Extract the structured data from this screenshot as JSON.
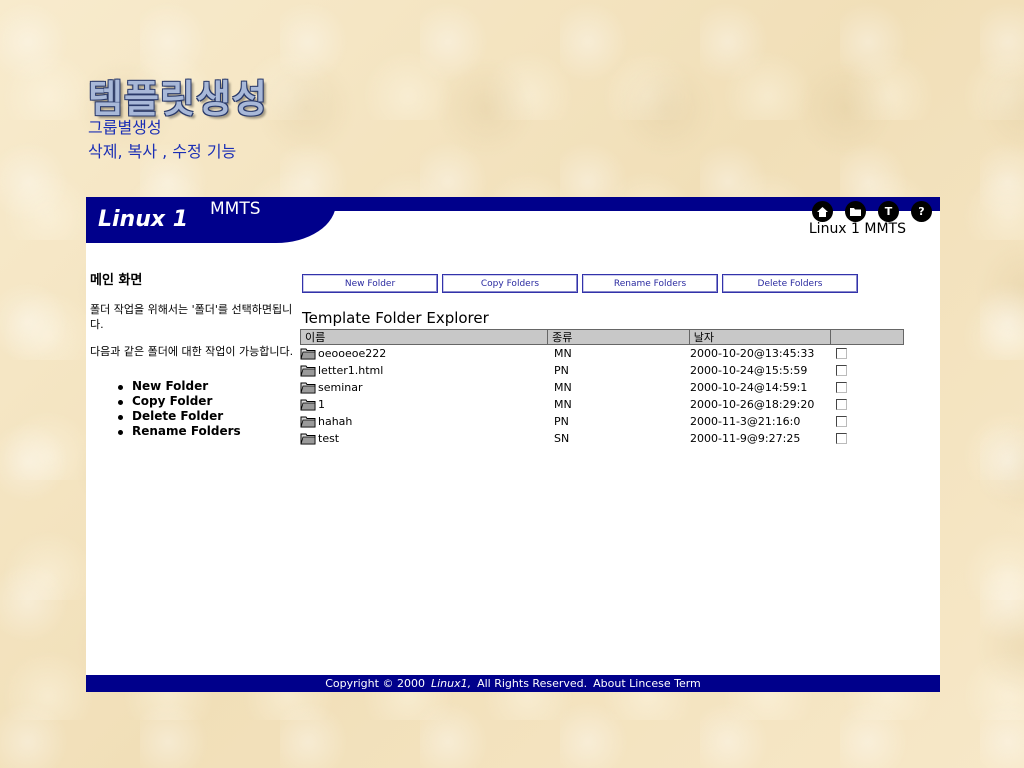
{
  "slide": {
    "title": "템플릿생성",
    "subtitle_1": "그룹별생성",
    "subtitle_2": "삭제, 복사 , 수정 기능"
  },
  "header": {
    "logo": "Linux 1",
    "app_name": "MMTS",
    "right_label": "Linux 1 MMTS",
    "icons": [
      "home-icon",
      "folder-icon",
      "tools-icon",
      "help-icon"
    ]
  },
  "sidebar": {
    "title": "메인 화면",
    "text_1": "폴더 작업을 위해서는 '폴더'를 선택하면됩니다.",
    "text_2": "다음과 같은 폴더에 대한 작업이 가능합니다.",
    "items": [
      "New Folder",
      "Copy Folder",
      "Delete Folder",
      "Rename Folders"
    ]
  },
  "toolbar": {
    "buttons": [
      "New Folder",
      "Copy Folders",
      "Rename Folders",
      "Delete Folders"
    ]
  },
  "explorer": {
    "title": "Template Folder Explorer",
    "columns": [
      "이름",
      "종류",
      "날자",
      ""
    ],
    "rows": [
      {
        "name": "oeooeoe222",
        "type": "MN",
        "date": "2000-10-20@13:45:33"
      },
      {
        "name": "letter1.html",
        "type": "PN",
        "date": "2000-10-24@15:5:59"
      },
      {
        "name": "seminar",
        "type": "MN",
        "date": "2000-10-24@14:59:1"
      },
      {
        "name": "1",
        "type": "MN",
        "date": "2000-10-26@18:29:20"
      },
      {
        "name": "hahah",
        "type": "PN",
        "date": "2000-11-3@21:16:0"
      },
      {
        "name": "test",
        "type": "SN",
        "date": "2000-11-9@9:27:25"
      }
    ]
  },
  "footer": {
    "part_1": "Copyright © 2000",
    "brand": "Linux1,",
    "part_2": "All Rights Reserved.",
    "part_3": "About Lincese Term"
  },
  "colors": {
    "header_blue": "#00008b",
    "subtitle_blue": "#1b2fb5",
    "button_text": "#2a2aa0"
  }
}
